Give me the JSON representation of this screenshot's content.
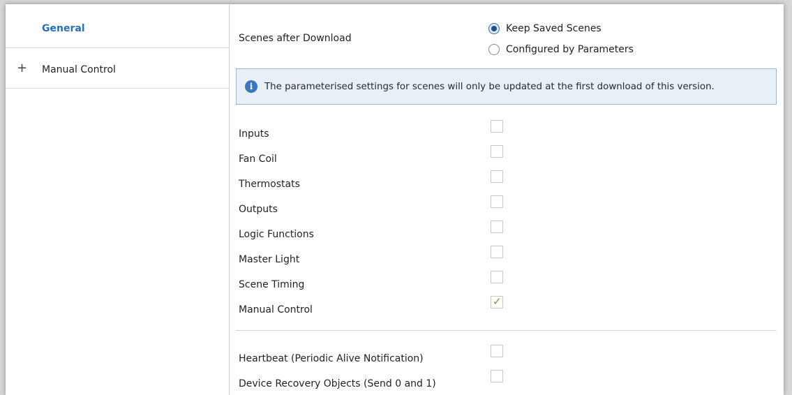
{
  "sidebar": {
    "items": [
      {
        "label": "General",
        "selected": true
      },
      {
        "label": "Manual Control",
        "expand_icon": "plus-icon"
      }
    ]
  },
  "scenes": {
    "label": "Scenes after Download",
    "options": [
      {
        "label": "Keep Saved Scenes",
        "checked": true
      },
      {
        "label": "Configured by Parameters",
        "checked": false
      }
    ]
  },
  "info_banner": {
    "icon": "info-icon",
    "text": "The parameterised settings for scenes will only be updated at the first download of this version."
  },
  "modules": [
    {
      "label": "Inputs",
      "checked": false
    },
    {
      "label": "Fan Coil",
      "checked": false
    },
    {
      "label": "Thermostats",
      "checked": false
    },
    {
      "label": "Outputs",
      "checked": false
    },
    {
      "label": "Logic Functions",
      "checked": false
    },
    {
      "label": "Master Light",
      "checked": false
    },
    {
      "label": "Scene Timing",
      "checked": false
    },
    {
      "label": "Manual Control",
      "checked": true
    }
  ],
  "extras": [
    {
      "label": "Heartbeat (Periodic Alive Notification)",
      "checked": false
    },
    {
      "label": "Device Recovery Objects (Send 0 and 1)",
      "checked": false
    }
  ],
  "colors": {
    "accent": "#2a6fb6",
    "check": "#5aa53a",
    "info_bg": "#e8f0f7"
  }
}
